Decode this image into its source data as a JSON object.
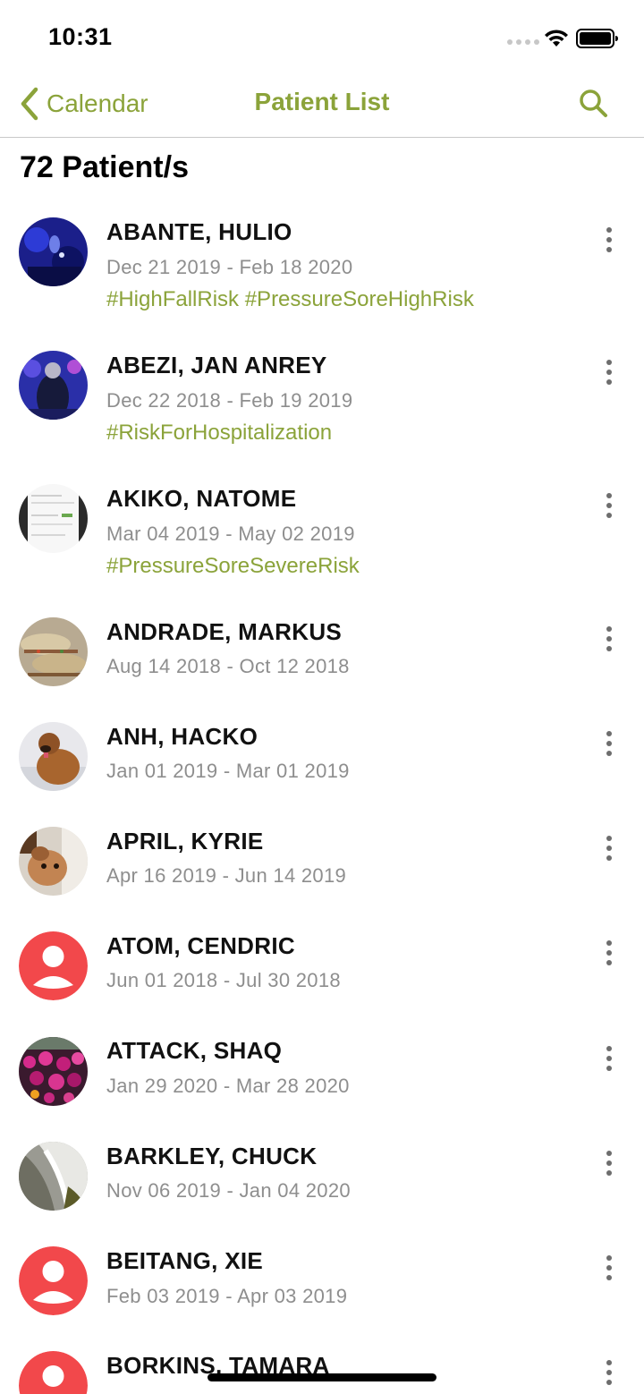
{
  "status_bar": {
    "time": "10:31",
    "icons": [
      "signal-dots-icon",
      "wifi-icon",
      "battery-icon"
    ]
  },
  "nav": {
    "back_label": "Calendar",
    "title": "Patient List",
    "search_icon": "search-icon",
    "accent_color": "#8ba33a"
  },
  "header": {
    "count_label": "72 Patient/s"
  },
  "patients": [
    {
      "name": "ABANTE, HULIO",
      "dates": "Dec 21 2019 - Feb 18 2020",
      "tags": "#HighFallRisk #PressureSoreHighRisk",
      "avatar": "photo-dark-blue"
    },
    {
      "name": "ABEZI, JAN ANREY",
      "dates": "Dec 22 2018 - Feb 19 2019",
      "tags": "#RiskForHospitalization",
      "avatar": "photo-person-night"
    },
    {
      "name": "AKIKO, NATOME",
      "dates": "Mar 04 2019 - May 02 2019",
      "tags": "#PressureSoreSevereRisk",
      "avatar": "photo-screenshot"
    },
    {
      "name": "ANDRADE, MARKUS",
      "dates": "Aug 14 2018 - Oct 12 2018",
      "tags": "",
      "avatar": "photo-food"
    },
    {
      "name": "ANH, HACKO",
      "dates": "Jan 01 2019 - Mar 01 2019",
      "tags": "",
      "avatar": "photo-dog-snow"
    },
    {
      "name": "APRIL, KYRIE",
      "dates": "Apr 16 2019 - Jun 14 2019",
      "tags": "",
      "avatar": "photo-dog-indoor"
    },
    {
      "name": "ATOM, CENDRIC",
      "dates": "Jun 01 2018 - Jul 30 2018",
      "tags": "",
      "avatar": "default-user-icon"
    },
    {
      "name": "ATTACK, SHAQ",
      "dates": "Jan 29 2020 - Mar 28 2020",
      "tags": "",
      "avatar": "photo-flowers"
    },
    {
      "name": "BARKLEY, CHUCK",
      "dates": "Nov 06 2019 - Jan 04 2020",
      "tags": "",
      "avatar": "photo-waterfall"
    },
    {
      "name": "BEITANG, XIE",
      "dates": "Feb 03 2019 - Apr 03 2019",
      "tags": "",
      "avatar": "default-user-icon"
    },
    {
      "name": "BORKINS, TAMARA",
      "dates": "",
      "tags": "",
      "avatar": "default-user-icon"
    }
  ],
  "colors": {
    "default_avatar": "#f2484b",
    "dates_gray": "#8e8e8e"
  }
}
